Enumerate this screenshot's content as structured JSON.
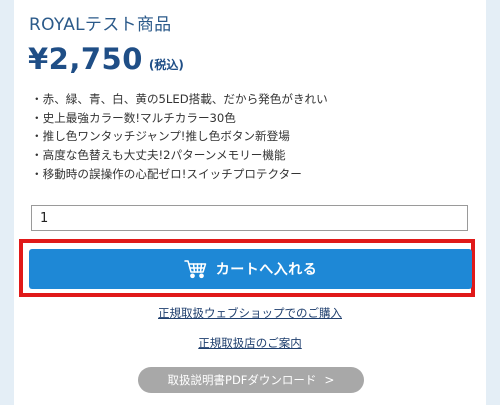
{
  "product": {
    "title": "ROYALテスト商品",
    "price": "¥2,750",
    "tax_note": "(税込)",
    "features": [
      "・赤、緑、青、白、黄の5LED搭載、だから発色がきれい",
      "・史上最強カラー数!マルチカラー30色",
      "・推し色ワンタッチジャンプ!推し色ボタン新登場",
      "・高度な色替えも大丈夫!2パターンメモリー機能",
      "・移動時の誤操作の心配ゼロ!スイッチプロテクター"
    ]
  },
  "quantity": {
    "value": "1"
  },
  "cart_button": {
    "label": "カートへ入れる",
    "icon": "cart-icon"
  },
  "links": {
    "official_shop": "正規取扱ウェブショップでのご購入",
    "official_store": "正規取扱店のご案内"
  },
  "pdf_button": {
    "label": "取扱説明書PDFダウンロード",
    "chevron": ">"
  },
  "colors": {
    "background": "#e4eef6",
    "accent": "#1e88d6",
    "price_text": "#1f4e86",
    "highlight": "#e01919",
    "pdf_button": "#a8a8a8"
  }
}
